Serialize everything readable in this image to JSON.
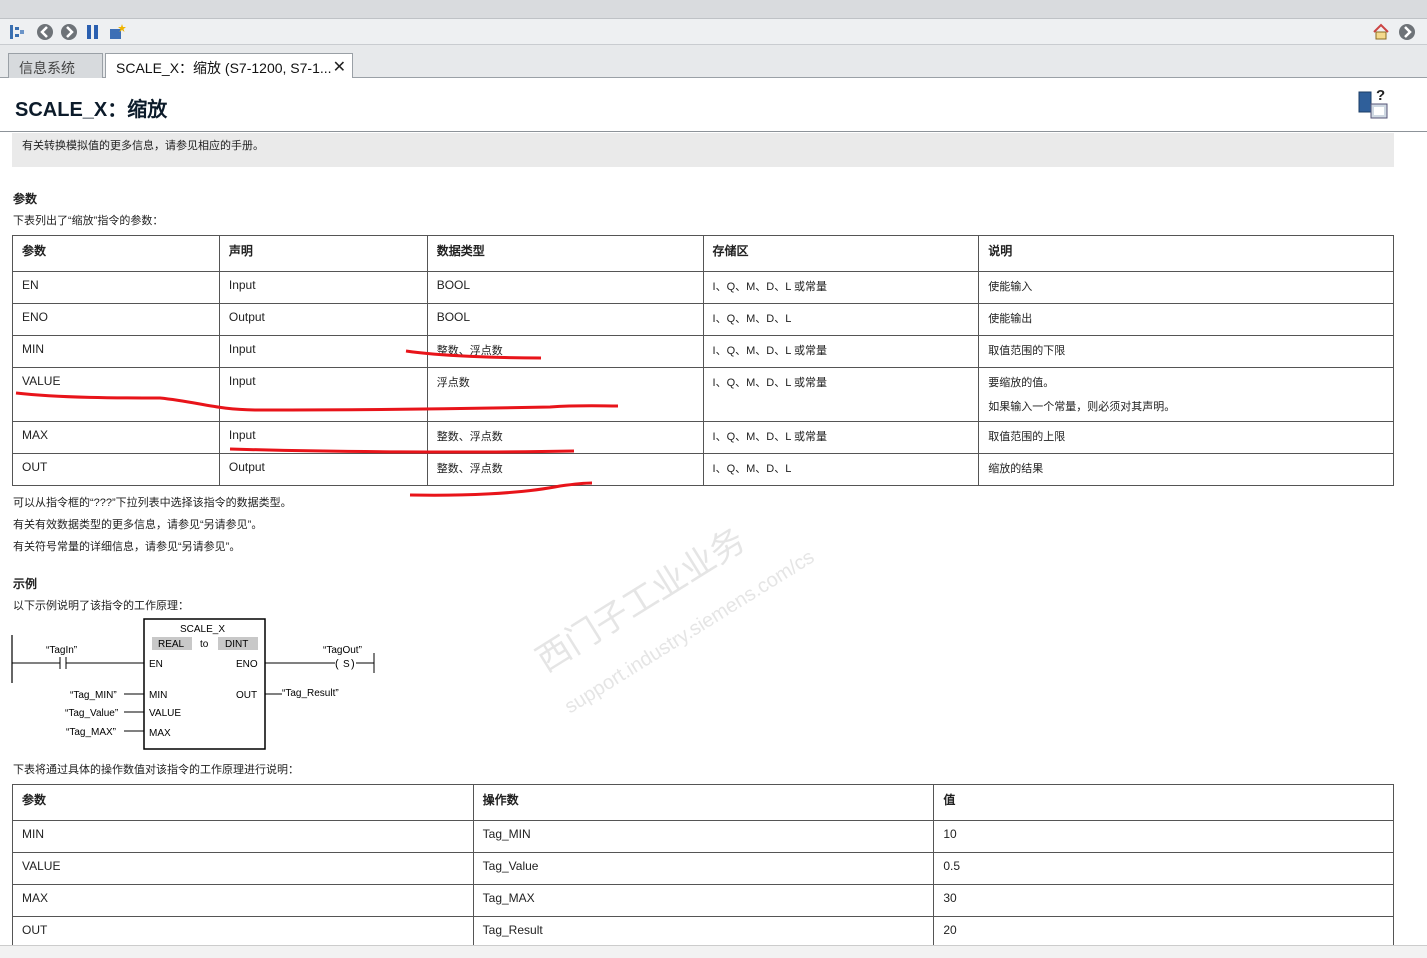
{
  "tabs": {
    "inactive": "信息系统",
    "active": "SCALE_X：缩放 (S7-1200, S7-1..."
  },
  "icons": {
    "tab_close": "close-icon",
    "nav": [
      "tree-icon",
      "back-icon",
      "forward-icon",
      "pause-icon",
      "star-icon"
    ],
    "home": "home-icon",
    "help": "help-icon"
  },
  "header": {
    "title": "SCALE_X：缩放"
  },
  "note": "有关转换模拟值的更多信息，请参见相应的手册。",
  "params": {
    "heading": "参数",
    "intro": "下表列出了“缩放”指令的参数：",
    "columns": [
      "参数",
      "声明",
      "数据类型",
      "存储区",
      "说明"
    ],
    "rows": [
      {
        "p": "EN",
        "d": "Input",
        "t": "BOOL",
        "m": "I、Q、M、D、L 或常量",
        "s": "使能输入",
        "s2": ""
      },
      {
        "p": "ENO",
        "d": "Output",
        "t": "BOOL",
        "m": "I、Q、M、D、L",
        "s": "使能输出",
        "s2": ""
      },
      {
        "p": "MIN",
        "d": "Input",
        "t": "整数、浮点数",
        "m": "I、Q、M、D、L 或常量",
        "s": "取值范围的下限",
        "s2": ""
      },
      {
        "p": "VALUE",
        "d": "Input",
        "t": "浮点数",
        "m": "I、Q、M、D、L 或常量",
        "s": "要缩放的值。",
        "s2": "如果输入一个常量，则必须对其声明。"
      },
      {
        "p": "MAX",
        "d": "Input",
        "t": "整数、浮点数",
        "m": "I、Q、M、D、L 或常量",
        "s": "取值范围的上限",
        "s2": ""
      },
      {
        "p": "OUT",
        "d": "Output",
        "t": "整数、浮点数",
        "m": "I、Q、M、D、L",
        "s": "缩放的结果",
        "s2": ""
      }
    ],
    "notes": [
      "可以从指令框的“???”下拉列表中选择该指令的数据类型。",
      "有关有效数据类型的更多信息，请参见“另请参见”。",
      "有关符号常量的详细信息，请参见“另请参见”。"
    ]
  },
  "example": {
    "heading": "示例",
    "intro": "以下示例说明了该指令的工作原理：",
    "fbd": {
      "block": "SCALE_X",
      "from": "REAL",
      "to_word": "to",
      "to": "DINT",
      "en": "EN",
      "eno": "ENO",
      "min": "MIN",
      "value": "VALUE",
      "max": "MAX",
      "out": "OUT",
      "tag_in": "“TagIn”",
      "tag_out": "“TagOut”",
      "coil": "S",
      "tag_min": "“Tag_MIN”",
      "tag_value": "“Tag_Value”",
      "tag_max": "“Tag_MAX”",
      "tag_result": "“Tag_Result”"
    },
    "table_intro": "下表将通过具体的操作数值对该指令的工作原理进行说明：",
    "columns": [
      "参数",
      "操作数",
      "值"
    ],
    "rows": [
      {
        "p": "MIN",
        "o": "Tag_MIN",
        "v": "10"
      },
      {
        "p": "VALUE",
        "o": "Tag_Value",
        "v": "0.5"
      },
      {
        "p": "MAX",
        "o": "Tag_MAX",
        "v": "30"
      },
      {
        "p": "OUT",
        "o": "Tag_Result",
        "v": "20"
      }
    ]
  },
  "watermark": {
    "line1": "西门子工业业务",
    "line2": "support.industry.siemens.com/cs"
  },
  "colors": {
    "annotation_red": "#e8141a",
    "note_bg": "#eaeaea"
  }
}
